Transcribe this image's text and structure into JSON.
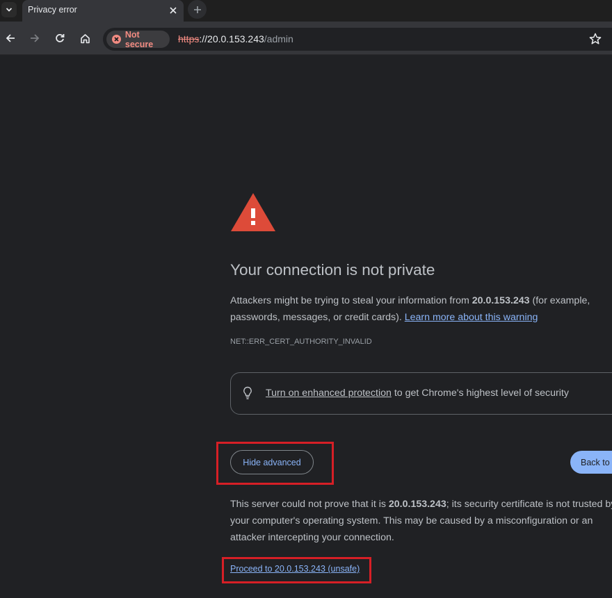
{
  "tab": {
    "title": "Privacy error",
    "close_label": "×",
    "new_tab_label": "+"
  },
  "toolbar": {
    "security_chip": "Not secure",
    "url_scheme": "https",
    "url_host": "://20.0.153.243",
    "url_path": "/admin"
  },
  "page": {
    "heading": "Your connection is not private",
    "para1_line1_prefix": "Attackers might be trying to steal your information from ",
    "para1_host": "20.0.153.243",
    "para1_line1_suffix": " (for example,",
    "para1_line2_prefix": "passwords, messages, or credit cards). ",
    "learn_more": "Learn more about this warning",
    "error_code": "NET::ERR_CERT_AUTHORITY_INVALID",
    "enhanced_link": "Turn on enhanced protection",
    "enhanced_suffix": " to get Chrome's highest level of security",
    "hide_advanced": "Hide advanced",
    "back_button": "Back to safety",
    "adv_line1_prefix": "This server could not prove that it is ",
    "adv_host": "20.0.153.243",
    "adv_line1_suffix": "; its security certificate is not trusted by",
    "adv_line2": "your computer's operating system. This may be caused by a misconfiguration or an",
    "adv_line3": "attacker intercepting your connection.",
    "proceed_link": "Proceed to 20.0.153.243 (unsafe)"
  },
  "colors": {
    "background": "#202124",
    "text": "#bdc1c6",
    "link": "#8ab4f8",
    "danger": "#dd4b39",
    "highlight_box": "#d61f26"
  },
  "icons": [
    "tab-search-icon",
    "close-icon",
    "plus-icon",
    "back-arrow-icon",
    "forward-arrow-icon",
    "reload-icon",
    "home-icon",
    "not-secure-icon",
    "star-icon",
    "warning-icon",
    "lightbulb-icon"
  ]
}
